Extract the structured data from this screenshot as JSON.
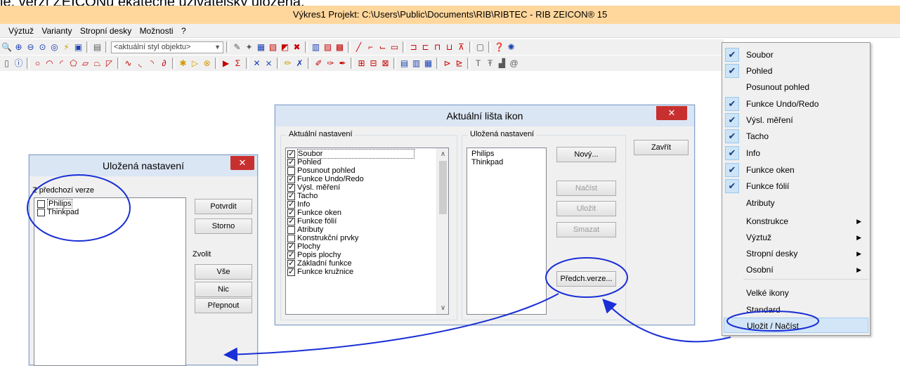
{
  "caption": "je. verzí ZEICONu ekatečně uživatelsky uložená.",
  "app": {
    "title": "Výkres1  Projekt: C:\\Users\\Public\\Documents\\RIB\\RIBTEC  -  RIB ZEICON® 15",
    "menu": [
      "Výztuž",
      "Varianty",
      "Stropní desky",
      "Možnosti",
      "?"
    ],
    "style_combo": "<aktuální styl objektu>"
  },
  "main_dialog": {
    "title": "Aktuální lišta ikon",
    "current_group": "Aktuální nastavení",
    "saved_group": "Uložená nastavení",
    "items": [
      {
        "label": "Soubor",
        "checked": true
      },
      {
        "label": "Pohled",
        "checked": true
      },
      {
        "label": "Posunout pohled",
        "checked": false
      },
      {
        "label": "Funkce Undo/Redo",
        "checked": true
      },
      {
        "label": "Výsl. měření",
        "checked": true
      },
      {
        "label": "Tacho",
        "checked": true
      },
      {
        "label": "Info",
        "checked": true
      },
      {
        "label": "Funkce oken",
        "checked": true
      },
      {
        "label": "Funkce fólií",
        "checked": true
      },
      {
        "label": "Atributy",
        "checked": false
      },
      {
        "label": "Konstrukční prvky",
        "checked": false
      },
      {
        "label": "Plochy",
        "checked": true
      },
      {
        "label": "Popis plochy",
        "checked": true
      },
      {
        "label": "Základní funkce",
        "checked": true
      },
      {
        "label": "Funkce kružnice",
        "checked": true
      }
    ],
    "saved": [
      "Philips",
      "Thinkpad"
    ],
    "buttons": {
      "new": "Nový...",
      "load": "Načíst",
      "save": "Uložit",
      "delete": "Smazat",
      "prev_version": "Předch.verze...",
      "close": "Zavřít"
    }
  },
  "saved_dialog": {
    "title": "Uložená nastavení",
    "group_label": "Z předchozí verze",
    "items": [
      "Philips",
      "Thinkpad"
    ],
    "confirm": "Potvrdit",
    "cancel": "Storno",
    "select_label": "Zvolit",
    "all": "Vše",
    "none": "Nic",
    "toggle": "Přepnout"
  },
  "context_menu": {
    "items": [
      {
        "label": "Soubor",
        "checked": true,
        "submenu": false
      },
      {
        "label": "Pohled",
        "checked": true,
        "submenu": false
      },
      {
        "label": "Posunout pohled",
        "checked": false,
        "submenu": false
      },
      {
        "label": "Funkce Undo/Redo",
        "checked": true,
        "submenu": false
      },
      {
        "label": "Výsl. měření",
        "checked": true,
        "submenu": false
      },
      {
        "label": "Tacho",
        "checked": true,
        "submenu": false
      },
      {
        "label": "Info",
        "checked": true,
        "submenu": false
      },
      {
        "label": "Funkce oken",
        "checked": true,
        "submenu": false
      },
      {
        "label": "Funkce fólií",
        "checked": true,
        "submenu": false
      },
      {
        "label": "Atributy",
        "checked": false,
        "submenu": false
      },
      {
        "label": "Konstrukce",
        "checked": false,
        "submenu": true
      },
      {
        "label": "Výztuž",
        "checked": false,
        "submenu": true
      },
      {
        "label": "Stropní desky",
        "checked": false,
        "submenu": true
      },
      {
        "label": "Osobní",
        "checked": false,
        "submenu": true
      },
      {
        "label": "Velké ikony",
        "checked": false,
        "submenu": false
      },
      {
        "label": "Standard",
        "checked": false,
        "submenu": false
      },
      {
        "label": "Uložit / Načíst",
        "checked": false,
        "submenu": false
      }
    ]
  },
  "colors": {
    "annotation": "#1a2fd6",
    "title_bar": "#ffd79c",
    "close": "#c8302f"
  }
}
